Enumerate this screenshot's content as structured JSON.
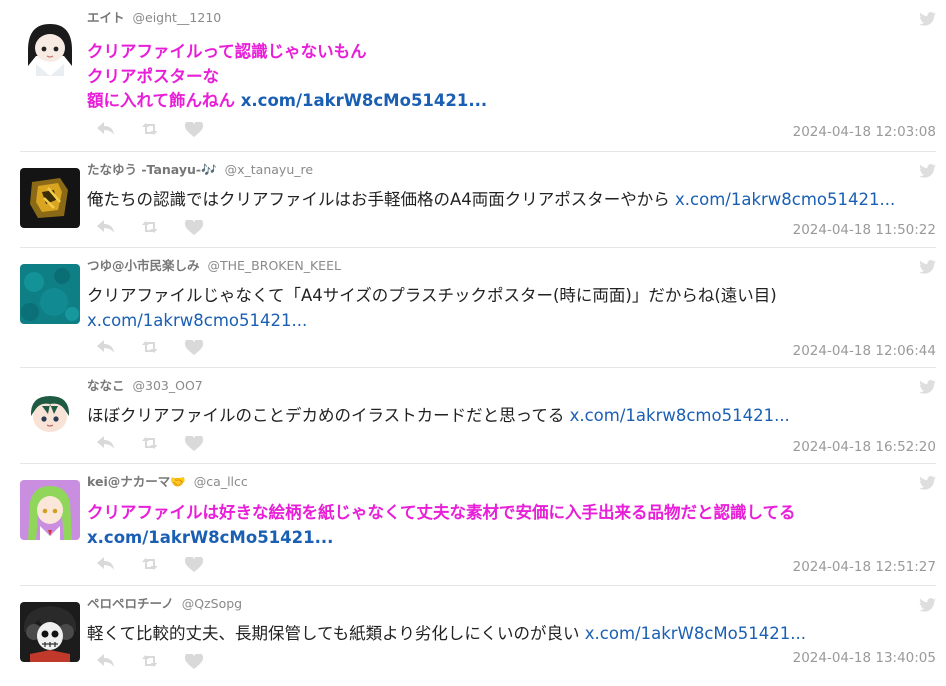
{
  "tweets": [
    {
      "display_name": "エイト",
      "handle": "@eight__1210",
      "lines": [
        "クリアファイルって認識じゃないもん",
        "クリアポスターな",
        "額に入れて飾んねん "
      ],
      "link": "x.com/1akrW8cMo51421...",
      "highlight": true,
      "timestamp": "2024-04-18 12:03:08",
      "avatar_icon": "avatar-anime-girl-icon"
    },
    {
      "display_name": "たなゆう -Tanayu-🎶",
      "handle": "@x_tanayu_re",
      "lines": [
        "俺たちの認識ではクリアファイルはお手軽価格のA4両面クリアポスターやから "
      ],
      "link": "x.com/1akrw8cmo51421...",
      "highlight": false,
      "timestamp": "2024-04-18 11:50:22",
      "avatar_icon": "avatar-gold-emblem-icon"
    },
    {
      "display_name": "つゆ@小市民楽しみ",
      "handle": "@THE_BROKEN_KEEL",
      "lines": [
        "クリアファイルじゃなくて「A4サイズのプラスチックポスター(時に両面)」だからね(遠い目)",
        ""
      ],
      "link": "x.com/1akrw8cmo51421...",
      "highlight": false,
      "timestamp": "2024-04-18 12:06:44",
      "avatar_icon": "avatar-teal-texture-icon"
    },
    {
      "display_name": "ななこ",
      "handle": "@303_OO7",
      "lines": [
        "ほぼクリアファイルのことデカめのイラストカードだと思ってる "
      ],
      "link": "x.com/1akrw8cmo51421...",
      "highlight": false,
      "timestamp": "2024-04-18 16:52:20",
      "avatar_icon": "avatar-chibi-character-icon"
    },
    {
      "display_name": "kei@ナカーマ🤝",
      "handle": "@ca_llcc",
      "lines": [
        "クリアファイルは好きな絵柄を紙じゃなくて丈夫な素材で安価に入手出来る品物だと認識してる",
        ""
      ],
      "link": "x.com/1akrW8cMo51421...",
      "highlight": true,
      "timestamp": "2024-04-18 12:51:27",
      "avatar_icon": "avatar-green-hair-girl-icon"
    },
    {
      "display_name": "ペロペロチーノ",
      "handle": "@QzSopg",
      "lines": [
        "軽くて比較的丈夫、長期保管しても紙類より劣化しにくいのが良い "
      ],
      "link": "x.com/1akrW8cMo51421...",
      "highlight": false,
      "timestamp": "2024-04-18 13:40:05",
      "avatar_icon": "avatar-skull-character-icon"
    }
  ],
  "action_icons": [
    "reply-icon",
    "retweet-icon",
    "like-icon"
  ],
  "brand_icon": "twitter-bird-icon",
  "colors": {
    "highlight_text": "#e81ed8",
    "link": "#1a5fb4",
    "meta_gray": "#9a9a9a",
    "icon_gray": "#d9d9d9"
  }
}
